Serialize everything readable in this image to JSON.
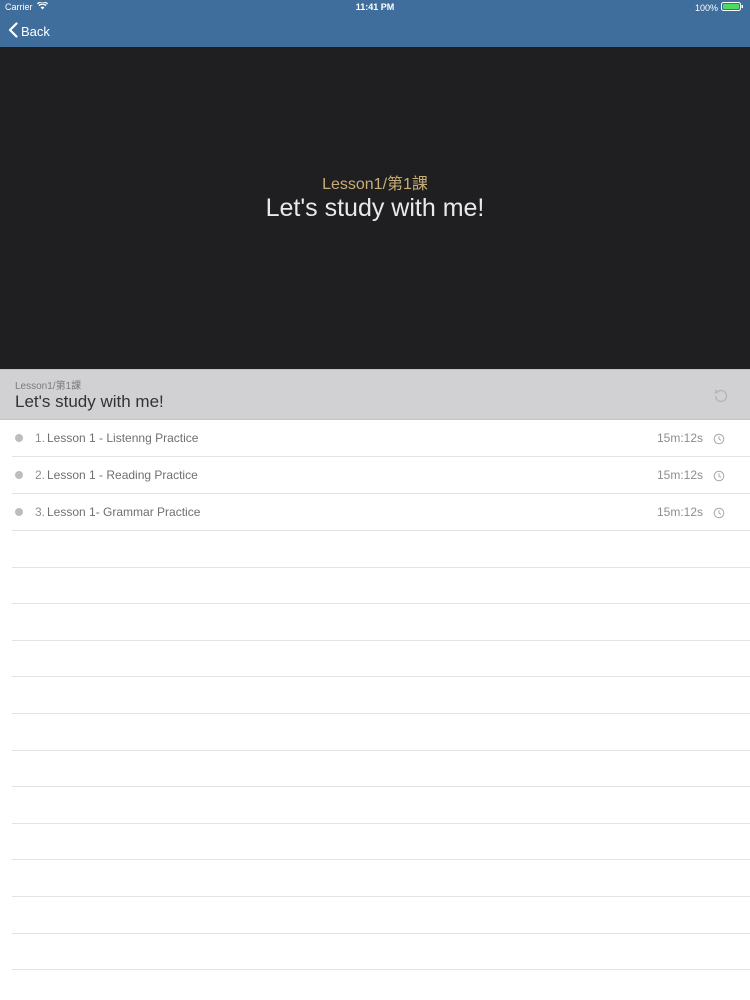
{
  "status_bar": {
    "carrier": "Carrier",
    "time": "11:41 PM",
    "battery": "100%"
  },
  "nav": {
    "back_label": "Back"
  },
  "video": {
    "subtitle": "Lesson1/第1課",
    "title": "Let's study with me!"
  },
  "section": {
    "subtitle": "Lesson1/第1課",
    "title": "Let's study with me!"
  },
  "lessons": [
    {
      "number": "1.",
      "name": "Lesson 1 - Listenng Practice",
      "duration": "15m:12s"
    },
    {
      "number": "2.",
      "name": "Lesson 1 - Reading Practice",
      "duration": "15m:12s"
    },
    {
      "number": "3.",
      "name": "Lesson 1- Grammar Practice",
      "duration": "15m:12s"
    }
  ],
  "icons": {
    "back": "chevron-left-icon",
    "wifi": "wifi-icon",
    "battery": "battery-icon",
    "refresh": "refresh-icon",
    "duration": "clock-icon"
  },
  "colors": {
    "nav_bar": "#3f6d9c",
    "video_bg": "#1f1f21",
    "subtitle_gold": "#c7ad74",
    "section_bg": "#d1d1d3",
    "battery_green": "#4cd964"
  }
}
